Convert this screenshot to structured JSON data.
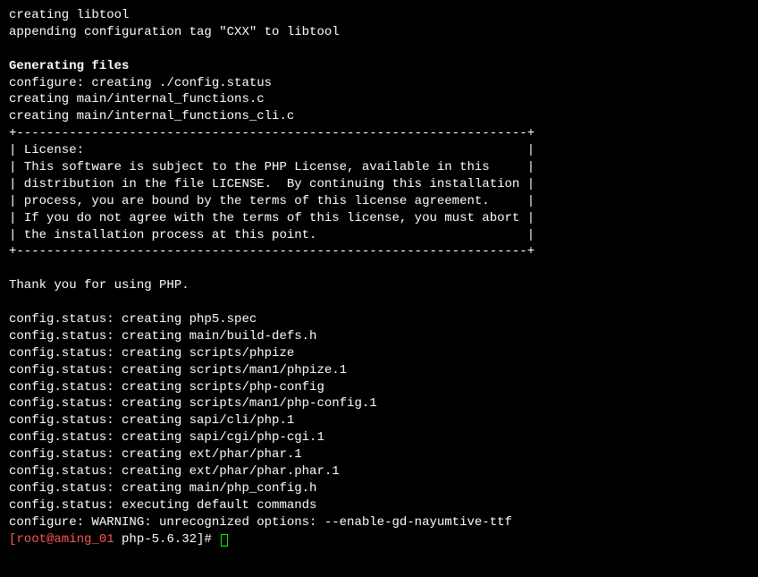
{
  "lines": {
    "l0": "creating libtool",
    "l1": "appending configuration tag \"CXX\" to libtool",
    "l2_heading": "Generating files",
    "l3": "configure: creating ./config.status",
    "l4": "creating main/internal_functions.c",
    "l5": "creating main/internal_functions_cli.c",
    "l6": "+--------------------------------------------------------------------+",
    "l7": "| License:                                                           |",
    "l8": "| This software is subject to the PHP License, available in this     |",
    "l9": "| distribution in the file LICENSE.  By continuing this installation |",
    "l10": "| process, you are bound by the terms of this license agreement.     |",
    "l11": "| If you do not agree with the terms of this license, you must abort |",
    "l12": "| the installation process at this point.                            |",
    "l13": "+--------------------------------------------------------------------+",
    "l14": "Thank you for using PHP.",
    "l15": "config.status: creating php5.spec",
    "l16": "config.status: creating main/build-defs.h",
    "l17": "config.status: creating scripts/phpize",
    "l18": "config.status: creating scripts/man1/phpize.1",
    "l19": "config.status: creating scripts/php-config",
    "l20": "config.status: creating scripts/man1/php-config.1",
    "l21": "config.status: creating sapi/cli/php.1",
    "l22": "config.status: creating sapi/cgi/php-cgi.1",
    "l23": "config.status: creating ext/phar/phar.1",
    "l24": "config.status: creating ext/phar/phar.phar.1",
    "l25": "config.status: creating main/php_config.h",
    "l26": "config.status: executing default commands",
    "l27": "configure: WARNING: unrecognized options: --enable-gd-nayumtive-ttf"
  },
  "prompt": {
    "user_host": "[root@aming_01 ",
    "cwd_close": "php-5.6.32]# "
  }
}
